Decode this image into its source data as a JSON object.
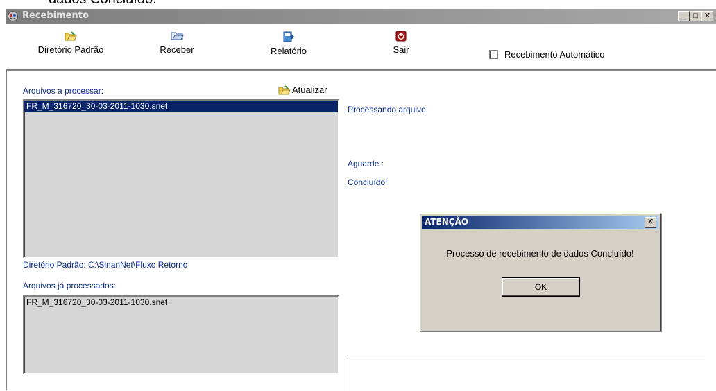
{
  "caption": {
    "text": "dados Concluído."
  },
  "window": {
    "title": "Recebimento",
    "controls": {
      "minimize": "_",
      "maximize": "□",
      "close": "✕"
    }
  },
  "toolbar": {
    "default_dir_label": "Diretório Padrão",
    "receive_label": "Receber",
    "report_label": "Relatório",
    "exit_label": "Sair",
    "auto_receive_label": "Recebimento Automático",
    "auto_receive_checked": false
  },
  "main": {
    "to_process_label": "Arquivos a processar:",
    "refresh_label": "Atualizar",
    "to_process_files": [
      "FR_M_316720_30-03-2011-1030.snet"
    ],
    "default_dir_text": "Diretório Padrão: C:\\SinanNet\\Fluxo Retorno",
    "processed_label": "Arquivos já processados:",
    "processed_files": [
      "FR_M_316720_30-03-2011-1030.snet"
    ],
    "processing_label": "Processando arquivo:",
    "wait_label": "Aguarde :",
    "done_label": "Concluído!"
  },
  "dialog": {
    "title": "ATENÇÃO",
    "close": "✕",
    "message": "Processo de recebimento de dados Concluído!",
    "ok_label": "OK"
  },
  "colors": {
    "label_blue": "#0a2d8c",
    "selection": "#0a246a",
    "titlebar_inactive": "#8c8c8c"
  }
}
